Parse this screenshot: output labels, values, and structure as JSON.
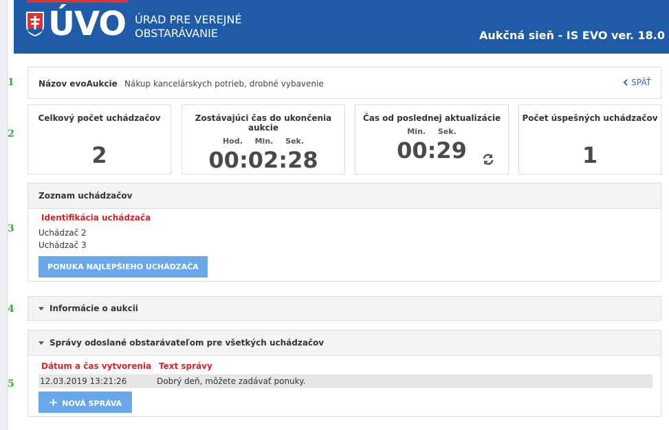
{
  "header": {
    "logo_text": "ÚVO",
    "org_line1": "ÚRAD PRE VEREJNÉ",
    "org_line2": "OBSTARÁVANIE",
    "app_title": "Aukčná sieň - IS EVO ver. 18.0",
    "brand_blue": "#1f5ba6",
    "brand_red": "#d0363a"
  },
  "markers": [
    "1",
    "2",
    "3",
    "4",
    "5"
  ],
  "auction": {
    "name_label": "Názov evoAukcie",
    "name_value": "Nákup kancelárskych potrieb, drobné vybavenie",
    "back_label": "SPÄŤ"
  },
  "stats": {
    "total_bidders": {
      "title": "Celkový počet uchádzačov",
      "value": "2"
    },
    "remaining_time": {
      "title": "Zostávajúci čas do ukončenia aukcie",
      "units": "Hod. Min. Sek.",
      "value": "00:02:28"
    },
    "since_update": {
      "title": "Čas od poslednej aktualizácie",
      "units": "Min. Sek.",
      "value": "00:29"
    },
    "successful_bidders": {
      "title": "Počet úspešných uchádzačov",
      "value": "1"
    }
  },
  "bidders": {
    "section_title": "Zoznam uchádzačov",
    "column_title": "Identifikácia uchádzača",
    "items": [
      "Uchádzač 2",
      "Uchádzač 3"
    ],
    "best_offer_button": "PONUKA NAJLEPŠIEHO UCHÁDZAČA"
  },
  "auction_info": {
    "section_title": "Informácie o aukcii"
  },
  "messages": {
    "section_title": "Správy odoslané obstarávateľom pre všetkých uchádzačov",
    "col_date": "Dátum a čas vytvorenia",
    "col_text": "Text správy",
    "rows": [
      {
        "date": "12.03.2019 13:21:26",
        "text": "Dobrý deň, môžete zadávať ponuky."
      }
    ],
    "new_button": "NOVÁ SPRÁVA"
  },
  "colors": {
    "accent_button": "#6aa7e8",
    "red_text": "#d0242a",
    "marker_green": "#3aa63a"
  }
}
